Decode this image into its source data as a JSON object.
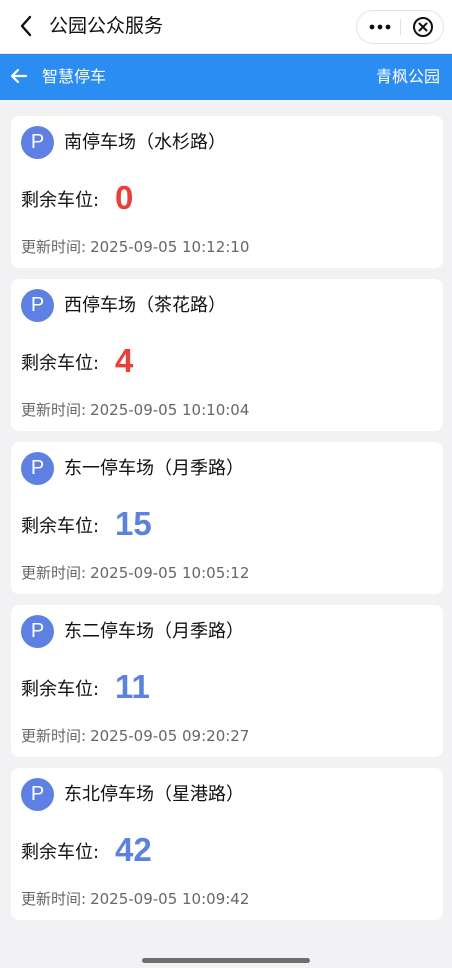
{
  "header": {
    "title": "公园公众服务"
  },
  "subheader": {
    "title": "智慧停车",
    "park_name": "青枫公园"
  },
  "labels": {
    "remaining": "剩余车位:",
    "updated": "更新时间:",
    "parking_icon": "P"
  },
  "colors": {
    "zero_or_low": "#e8413c",
    "normal": "#5b82e0",
    "header_blue": "#2b8cf1"
  },
  "lots": [
    {
      "name": "南停车场（水杉路）",
      "remaining": "0",
      "updated": "2025-09-05 10:12:10",
      "status": "low"
    },
    {
      "name": "西停车场（茶花路）",
      "remaining": "4",
      "updated": "2025-09-05 10:10:04",
      "status": "low"
    },
    {
      "name": "东一停车场（月季路）",
      "remaining": "15",
      "updated": "2025-09-05 10:05:12",
      "status": "normal"
    },
    {
      "name": "东二停车场（月季路）",
      "remaining": "11",
      "updated": "2025-09-05 09:20:27",
      "status": "normal"
    },
    {
      "name": "东北停车场（星港路）",
      "remaining": "42",
      "updated": "2025-09-05 10:09:42",
      "status": "normal"
    }
  ]
}
